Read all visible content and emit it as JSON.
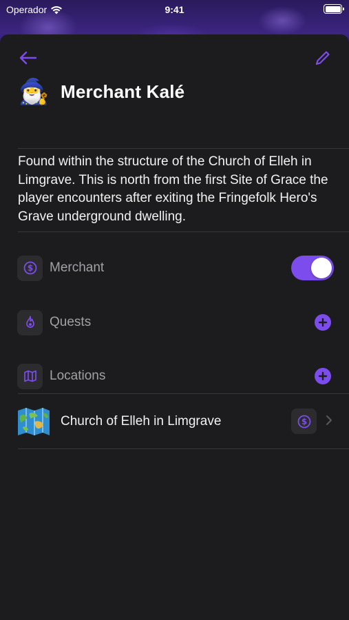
{
  "status_bar": {
    "carrier": "Operador",
    "time": "9:41"
  },
  "colors": {
    "accent": "#7c4dec",
    "sheet_background": "#1c1c1e",
    "icon_tile": "#2c2c2e",
    "secondary_text": "#a1a1a6"
  },
  "header": {
    "back_icon": "arrow-left-icon",
    "edit_icon": "pencil-icon"
  },
  "npc": {
    "avatar_icon": "mage-emoji",
    "name": "Merchant Kalé",
    "description": "Found within the structure of the Church of Elleh in Limgrave. This is north from the first Site of Grace the player encounters after exiting the Fringefolk Hero's Grave underground dwelling."
  },
  "sections": {
    "merchant": {
      "label": "Merchant",
      "icon": "dollar-circle-icon",
      "enabled": true
    },
    "quests": {
      "label": "Quests",
      "icon": "flame-icon"
    },
    "locations": {
      "label": "Locations",
      "icon": "map-icon"
    }
  },
  "locations_list": [
    {
      "name": "Church of Elleh in Limgrave",
      "thumbnail_icon": "world-map-emoji",
      "badge_icon": "dollar-circle-icon"
    }
  ]
}
